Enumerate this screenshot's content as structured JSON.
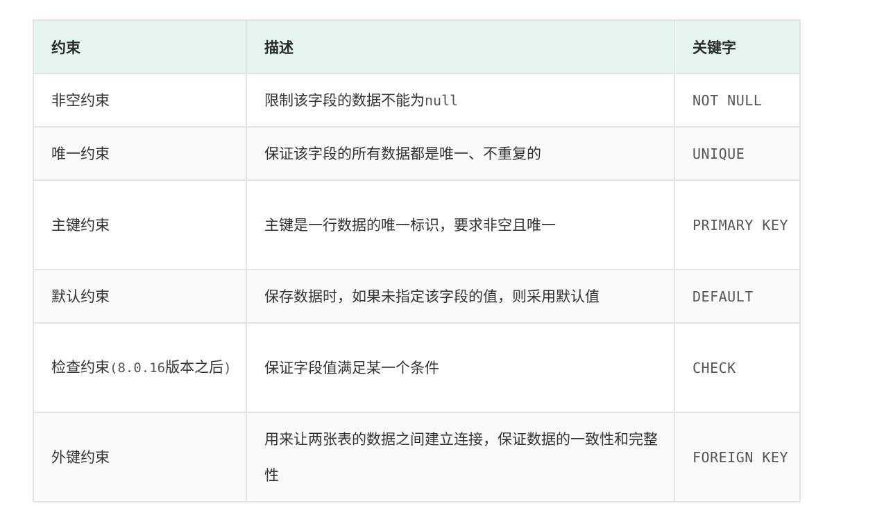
{
  "table": {
    "headers": [
      "约束",
      "描述",
      "关键字"
    ],
    "rows": [
      {
        "constraint": "非空约束",
        "description": "限制该字段的数据不能为",
        "description_code": "null",
        "keyword": "NOT NULL"
      },
      {
        "constraint": "唯一约束",
        "description": "保证该字段的所有数据都是唯一、不重复的",
        "keyword": "UNIQUE"
      },
      {
        "constraint": "主键约束",
        "description": "主键是一行数据的唯一标识，要求非空且唯一",
        "keyword": "PRIMARY KEY"
      },
      {
        "constraint": "默认约束",
        "description": "保存数据时，如果未指定该字段的值，则采用默认值",
        "keyword": "DEFAULT"
      },
      {
        "constraint": "检查约束",
        "constraint_note_open": "(",
        "constraint_note_version": "8.0.16",
        "constraint_note_text": "版本之后",
        "constraint_note_close": ")",
        "description": "保证字段值满足某一个条件",
        "keyword": "CHECK"
      },
      {
        "constraint": "外键约束",
        "description": "用来让两张表的数据之间建立连接，保证数据的一致性和完整性",
        "keyword": "FOREIGN KEY"
      }
    ]
  }
}
